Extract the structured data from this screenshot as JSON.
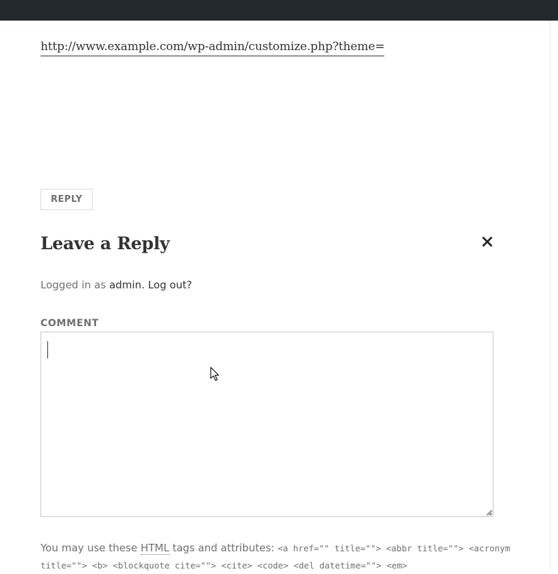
{
  "post": {
    "url_text": "http://www.example.com/wp-admin/customize.php?theme="
  },
  "comment_actions": {
    "reply_label": "REPLY"
  },
  "reply_form": {
    "title": "Leave a Reply",
    "cancel_glyph": "✕",
    "logged_in_prefix": "Logged in as ",
    "logged_in_user": "admin",
    "logged_in_separator": ". ",
    "logout_label": "Log out?",
    "comment_label": "COMMENT",
    "comment_value": "",
    "allowed_tags_prefix": "You may use these ",
    "allowed_tags_abbr": "HTML",
    "allowed_tags_middle": " tags and attributes: ",
    "allowed_tags_code": "<a href=\"\" title=\"\"> <abbr title=\"\"> <acronym title=\"\"> <b> <blockquote cite=\"\"> <cite> <code> <del datetime=\"\"> <em>"
  },
  "icons": {
    "close": "close-icon",
    "cursor": "mouse-pointer-icon",
    "resize": "resize-grip-icon"
  },
  "colors": {
    "admin_bar": "#23282d",
    "text": "#333333",
    "muted": "#707070",
    "border": "#c8c8c8"
  }
}
